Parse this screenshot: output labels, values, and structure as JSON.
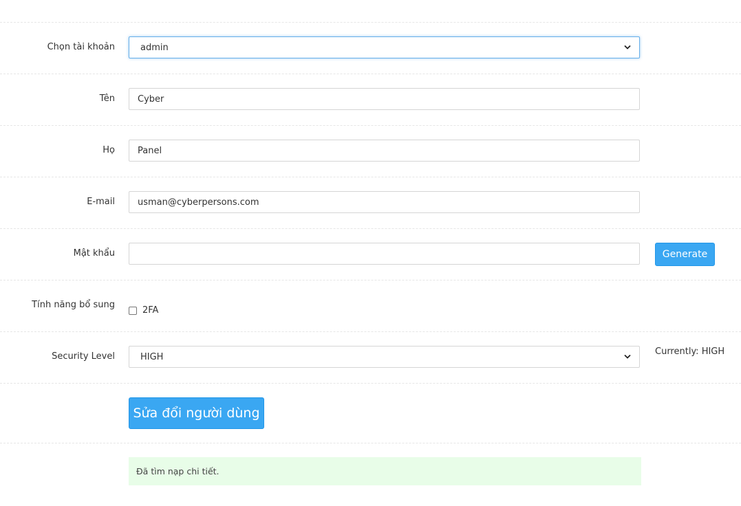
{
  "account": {
    "label": "Chọn tài khoản",
    "value": "admin"
  },
  "first_name": {
    "label": "Tên",
    "value": "Cyber"
  },
  "last_name": {
    "label": "Họ",
    "value": "Panel"
  },
  "email": {
    "label": "E-mail",
    "value": "usman@cyberpersons.com"
  },
  "password": {
    "label": "Mật khẩu",
    "value": "",
    "generate_label": "Generate"
  },
  "features": {
    "label": "Tính năng bổ sung",
    "twofa_label": "2FA",
    "twofa_checked": false
  },
  "security": {
    "label": "Security Level",
    "value": "HIGH",
    "current_text": "Currently: HIGH"
  },
  "submit_label": "Sửa đổi người dùng",
  "status_message": "Đã tìm nạp chi tiết.",
  "colors": {
    "primary_button": "#3aa7f2",
    "success_bg": "#e8fde8",
    "focus_border": "#66afe9"
  }
}
